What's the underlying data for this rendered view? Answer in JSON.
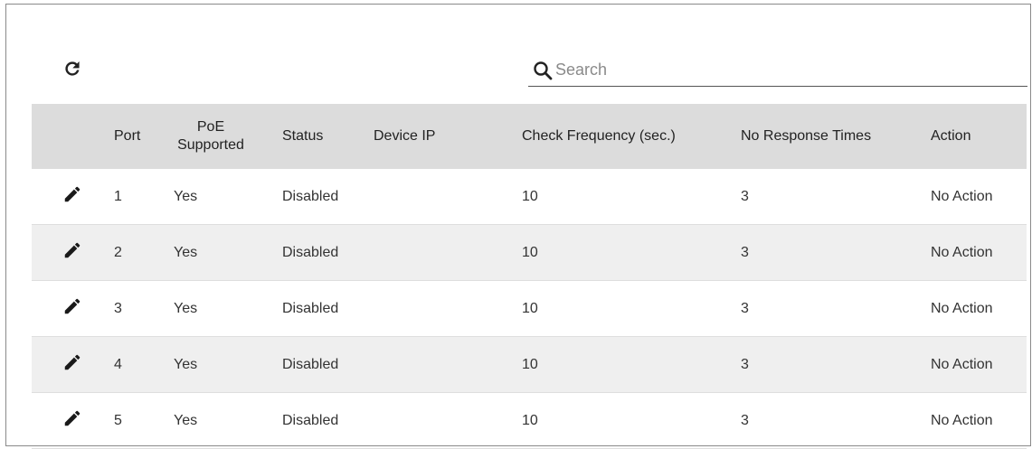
{
  "toolbar": {
    "refresh_icon": "refresh-icon"
  },
  "search": {
    "placeholder": "Search",
    "value": "",
    "icon": "search-icon"
  },
  "table": {
    "headers": {
      "edit": "",
      "port": "Port",
      "poe": "PoE Supported",
      "status": "Status",
      "device_ip": "Device IP",
      "check_frequency": "Check Frequency (sec.)",
      "no_response": "No Response Times",
      "action": "Action"
    },
    "rows": [
      {
        "port": "1",
        "poe": "Yes",
        "status": "Disabled",
        "device_ip": "",
        "check_frequency": "10",
        "no_response": "3",
        "action": "No Action"
      },
      {
        "port": "2",
        "poe": "Yes",
        "status": "Disabled",
        "device_ip": "",
        "check_frequency": "10",
        "no_response": "3",
        "action": "No Action"
      },
      {
        "port": "3",
        "poe": "Yes",
        "status": "Disabled",
        "device_ip": "",
        "check_frequency": "10",
        "no_response": "3",
        "action": "No Action"
      },
      {
        "port": "4",
        "poe": "Yes",
        "status": "Disabled",
        "device_ip": "",
        "check_frequency": "10",
        "no_response": "3",
        "action": "No Action"
      },
      {
        "port": "5",
        "poe": "Yes",
        "status": "Disabled",
        "device_ip": "",
        "check_frequency": "10",
        "no_response": "3",
        "action": "No Action"
      }
    ]
  },
  "colors": {
    "header_bg": "#dcdcdc",
    "row_alt_bg": "#efefef",
    "disabled_text": "#b5b5b5"
  }
}
